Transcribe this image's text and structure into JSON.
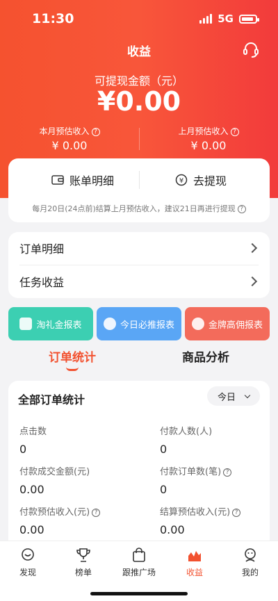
{
  "status_bar": {
    "time": "11:30",
    "network": "5G"
  },
  "header": {
    "title": "收益",
    "withdrawable_label": "可提现金额（元）",
    "withdrawable_amount": "¥0.00",
    "this_month_label": "本月预估收入",
    "this_month_value": "¥ 0.00",
    "last_month_label": "上月预估收入",
    "last_month_value": "¥ 0.00"
  },
  "actions": {
    "bill_label": "账单明细",
    "withdraw_label": "去提现",
    "tip": "每月20日(24点前)结算上月预估收入，建议21日再进行提现"
  },
  "list": {
    "order_detail": "订单明细",
    "task_income": "任务收益"
  },
  "reports": [
    {
      "label": "淘礼金报表",
      "color": "#3ccfb2"
    },
    {
      "label": "今日必推报表",
      "color": "#5aa6f5"
    },
    {
      "label": "金牌高佣报表",
      "color": "#f36b5b"
    }
  ],
  "tabs": {
    "order_stats": "订单统计",
    "product_analysis": "商品分析"
  },
  "stats": {
    "title": "全部订单统计",
    "period": "今日",
    "clicks_label": "点击数",
    "clicks_value": "0",
    "payers_label": "付款人数(人)",
    "payers_value": "0",
    "paid_amount_label": "付款成交金额(元)",
    "paid_amount_value": "0.00",
    "paid_orders_label": "付款订单数(笔)",
    "paid_orders_value": "0",
    "paid_est_label": "付款预估收入(元)",
    "paid_est_value": "0.00",
    "settle_est_label": "结算预估收入(元)",
    "settle_est_value": "0.00"
  },
  "bottom_nav": [
    "发现",
    "榜单",
    "跟推广场",
    "收益",
    "我的"
  ],
  "colors": {
    "accent": "#f2512f"
  }
}
